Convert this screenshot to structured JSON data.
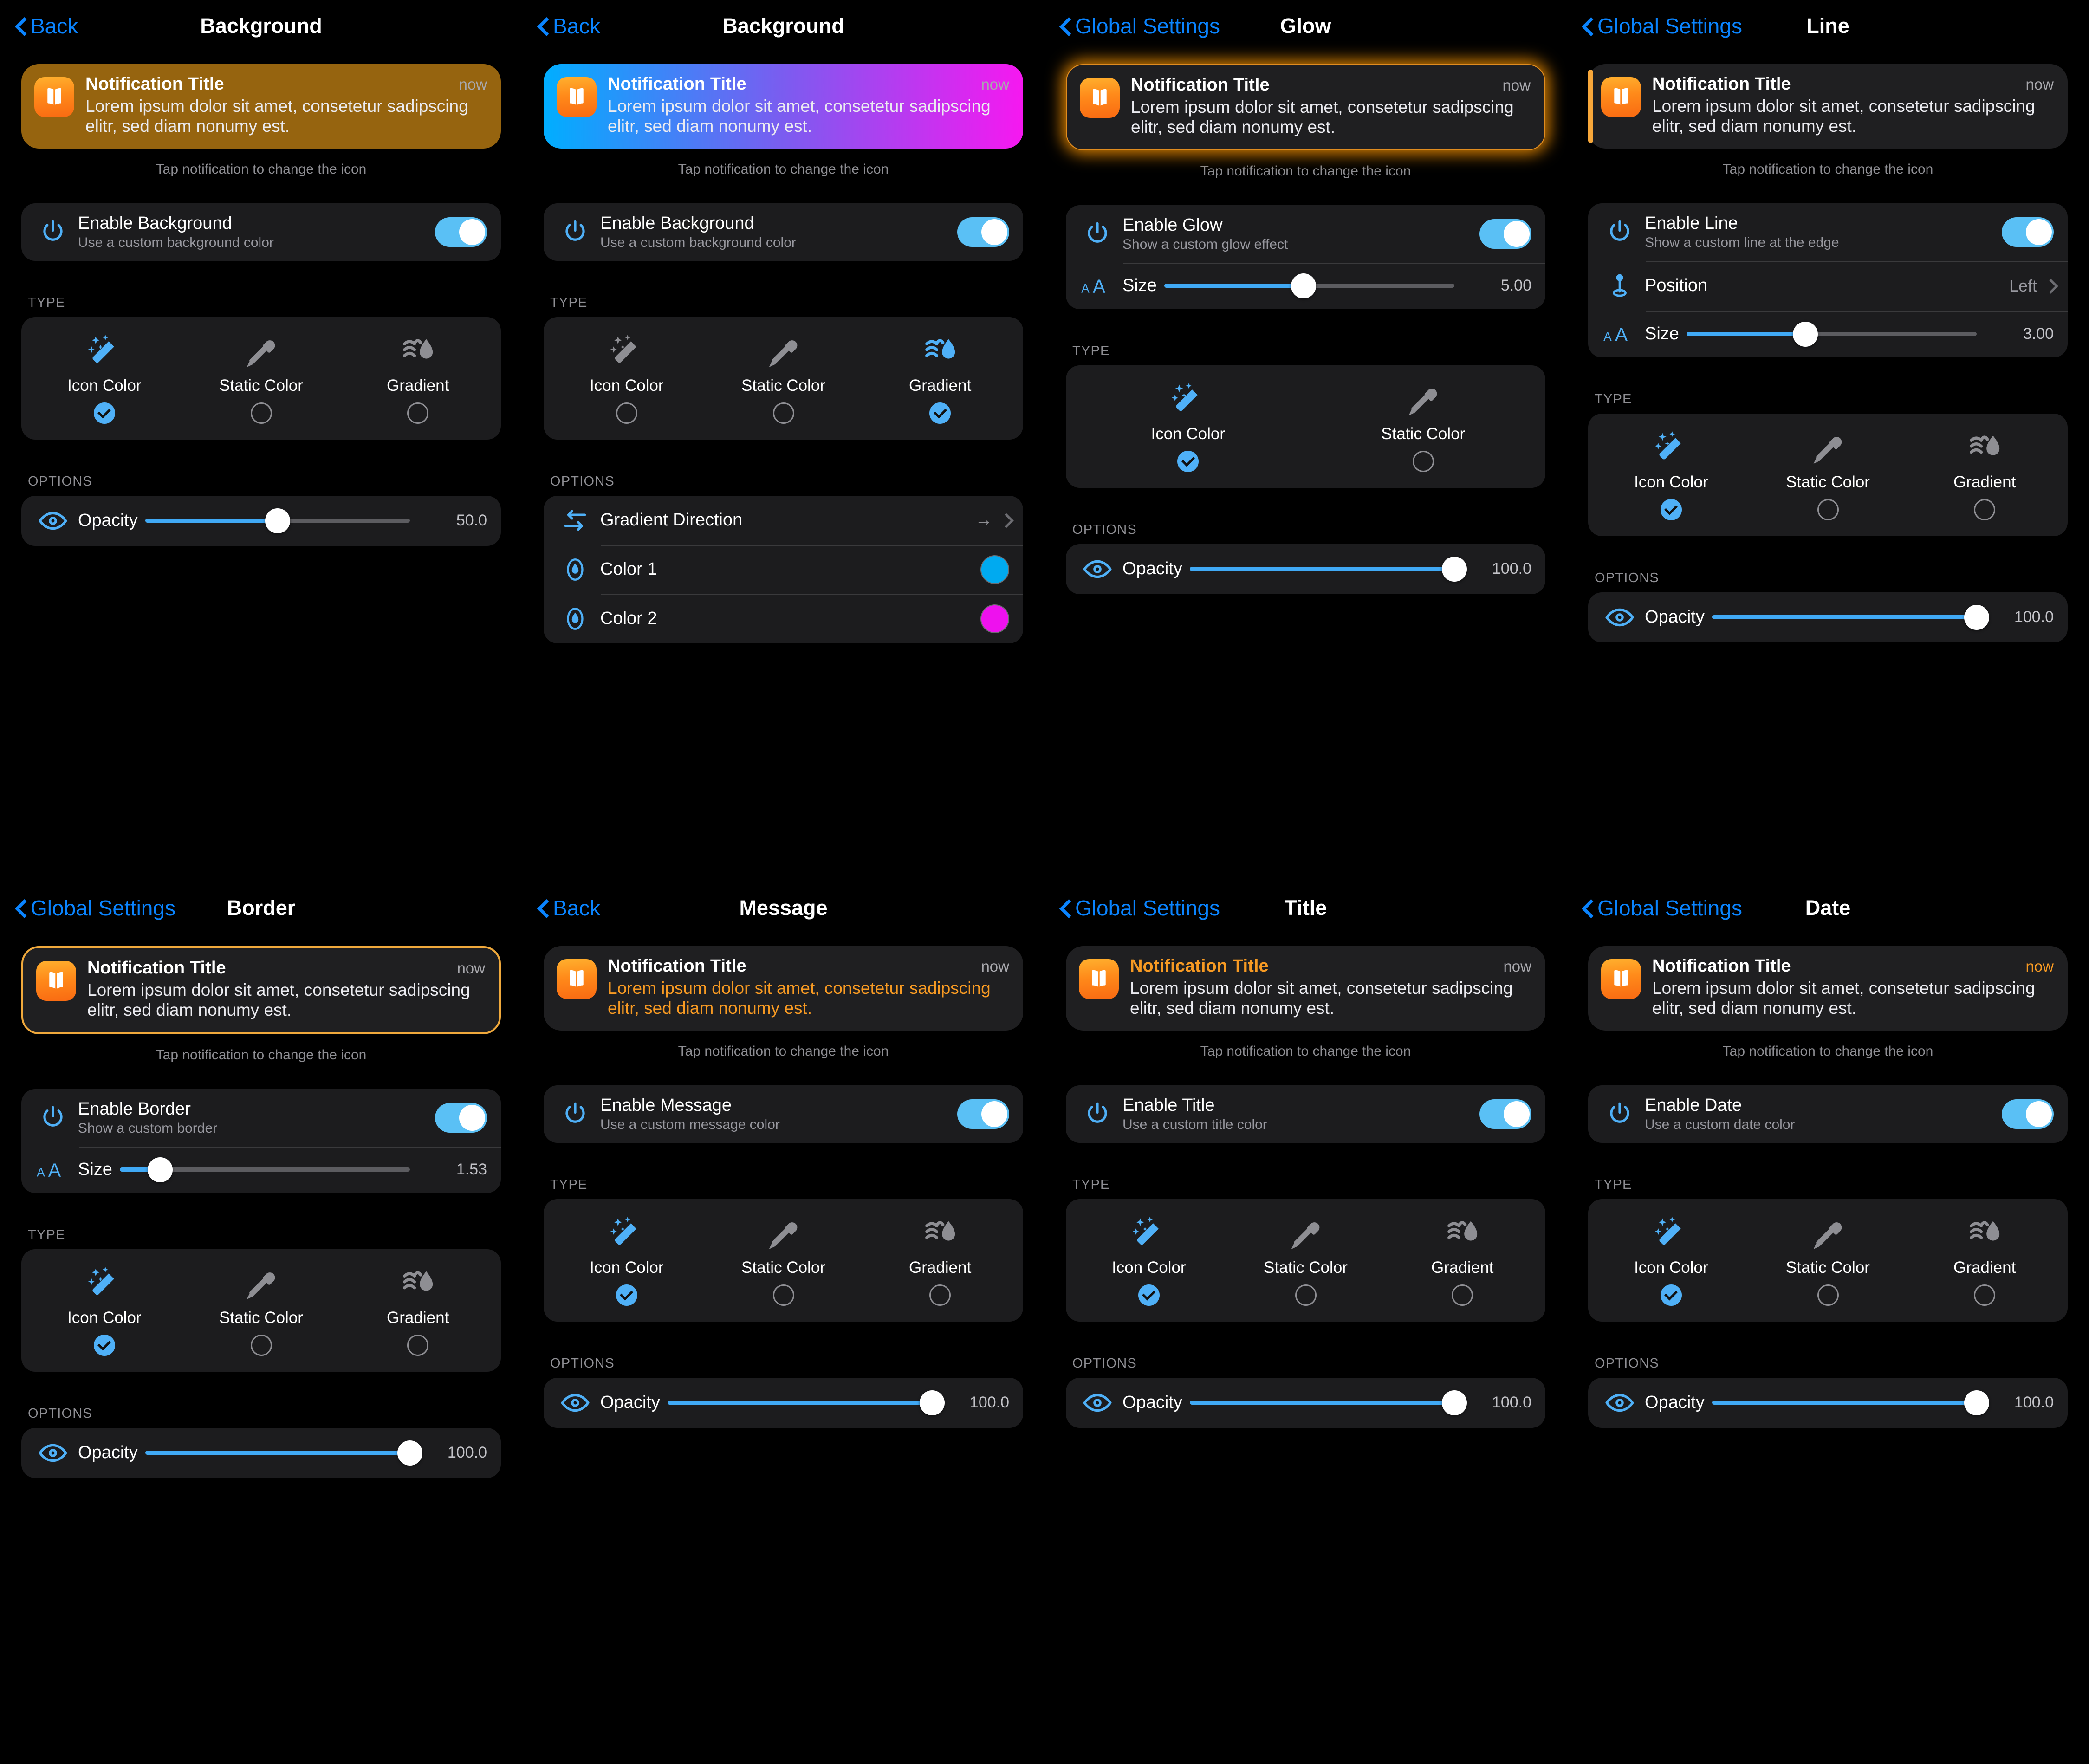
{
  "common": {
    "notification": {
      "title": "Notification Title",
      "time": "now",
      "message": "Lorem ipsum dolor sit amet, consetetur sadipscing elitr, sed diam nonumy est."
    },
    "hint": "Tap notification to change the icon",
    "labels": {
      "type": "TYPE",
      "options": "OPTIONS",
      "opacity": "Opacity",
      "size": "Size",
      "icon_color": "Icon Color",
      "static_color": "Static Color",
      "gradient": "Gradient"
    },
    "colors": {
      "accent_blue": "#0a84ff",
      "toggle_on": "#5ac0f5",
      "slider_fill": "#40a9f5",
      "orange": "#f79a23",
      "card_bg": "#1c1c1e",
      "page_bg": "#000000"
    }
  },
  "panels": [
    {
      "id": "background-icon-color",
      "nav": {
        "back": "Back",
        "title": "Background"
      },
      "preview_style": "solid-brown",
      "toggle": {
        "title": "Enable Background",
        "subtitle": "Use a custom background color",
        "value": true
      },
      "type": {
        "options": [
          "Icon Color",
          "Static Color",
          "Gradient"
        ],
        "selected": 0
      },
      "options": [
        {
          "kind": "slider",
          "label": "Opacity",
          "value": "50.0",
          "percent": 50
        }
      ]
    },
    {
      "id": "background-gradient",
      "nav": {
        "back": "Back",
        "title": "Background"
      },
      "preview_style": "gradient",
      "toggle": {
        "title": "Enable Background",
        "subtitle": "Use a custom background color",
        "value": true
      },
      "type": {
        "options": [
          "Icon Color",
          "Static Color",
          "Gradient"
        ],
        "selected": 2
      },
      "options": [
        {
          "kind": "nav",
          "label": "Gradient Direction",
          "value": "→"
        },
        {
          "kind": "color",
          "label": "Color 1",
          "color": "#00aaf0"
        },
        {
          "kind": "color",
          "label": "Color 2",
          "color": "#ee11ee"
        }
      ]
    },
    {
      "id": "glow",
      "nav": {
        "back": "Global Settings",
        "title": "Glow"
      },
      "preview_style": "glow",
      "toggle": {
        "title": "Enable Glow",
        "subtitle": "Show a custom glow effect",
        "value": true
      },
      "extra_rows": [
        {
          "kind": "slider",
          "icon": "text-size-icon",
          "label": "Size",
          "value": "5.00",
          "percent": 48
        }
      ],
      "type": {
        "options": [
          "Icon Color",
          "Static Color"
        ],
        "selected": 0
      },
      "options": [
        {
          "kind": "slider",
          "label": "Opacity",
          "value": "100.0",
          "percent": 100
        }
      ]
    },
    {
      "id": "line",
      "nav": {
        "back": "Global Settings",
        "title": "Line"
      },
      "preview_style": "line",
      "toggle": {
        "title": "Enable Line",
        "subtitle": "Show a custom line at the edge",
        "value": true
      },
      "extra_rows": [
        {
          "kind": "nav",
          "icon": "pin-icon",
          "label": "Position",
          "value": "Left"
        },
        {
          "kind": "slider",
          "icon": "text-size-icon",
          "label": "Size",
          "value": "3.00",
          "percent": 41
        }
      ],
      "type": {
        "options": [
          "Icon Color",
          "Static Color",
          "Gradient"
        ],
        "selected": 0
      },
      "options": [
        {
          "kind": "slider",
          "label": "Opacity",
          "value": "100.0",
          "percent": 100
        }
      ]
    },
    {
      "id": "border",
      "nav": {
        "back": "Global Settings",
        "title": "Border"
      },
      "preview_style": "border",
      "toggle": {
        "title": "Enable Border",
        "subtitle": "Show a custom border",
        "value": true
      },
      "extra_rows": [
        {
          "kind": "slider",
          "icon": "text-size-icon",
          "label": "Size",
          "value": "1.53",
          "percent": 14
        }
      ],
      "type": {
        "options": [
          "Icon Color",
          "Static Color",
          "Gradient"
        ],
        "selected": 0
      },
      "options": [
        {
          "kind": "slider",
          "label": "Opacity",
          "value": "100.0",
          "percent": 100
        }
      ]
    },
    {
      "id": "message",
      "nav": {
        "back": "Back",
        "title": "Message"
      },
      "preview_style": "message-accent",
      "toggle": {
        "title": "Enable Message",
        "subtitle": "Use a custom message color",
        "value": true
      },
      "type": {
        "options": [
          "Icon Color",
          "Static Color",
          "Gradient"
        ],
        "selected": 0
      },
      "options": [
        {
          "kind": "slider",
          "label": "Opacity",
          "value": "100.0",
          "percent": 100
        }
      ]
    },
    {
      "id": "title",
      "nav": {
        "back": "Global Settings",
        "title": "Title"
      },
      "preview_style": "title-accent",
      "toggle": {
        "title": "Enable Title",
        "subtitle": "Use a custom title color",
        "value": true
      },
      "type": {
        "options": [
          "Icon Color",
          "Static Color",
          "Gradient"
        ],
        "selected": 0
      },
      "options": [
        {
          "kind": "slider",
          "label": "Opacity",
          "value": "100.0",
          "percent": 100
        }
      ]
    },
    {
      "id": "date",
      "nav": {
        "back": "Global Settings",
        "title": "Date"
      },
      "preview_style": "date-accent",
      "toggle": {
        "title": "Enable Date",
        "subtitle": "Use a custom date color",
        "value": true
      },
      "type": {
        "options": [
          "Icon Color",
          "Static Color",
          "Gradient"
        ],
        "selected": 0
      },
      "options": [
        {
          "kind": "slider",
          "label": "Opacity",
          "value": "100.0",
          "percent": 100
        }
      ]
    }
  ]
}
